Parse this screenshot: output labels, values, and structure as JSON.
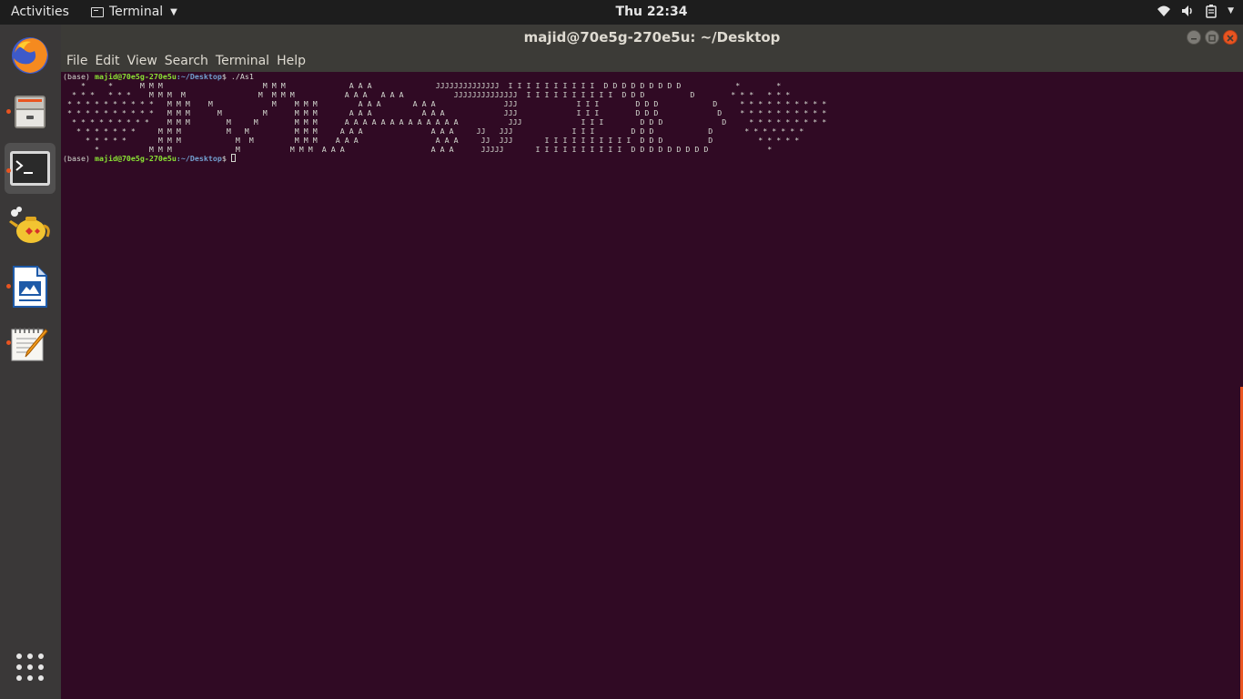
{
  "topbar": {
    "activities": "Activities",
    "app_name": "Terminal",
    "clock": "Thu 22:34"
  },
  "window": {
    "title": "majid@70e5g-270e5u: ~/Desktop",
    "menu": [
      "File",
      "Edit",
      "View",
      "Search",
      "Terminal",
      "Help"
    ]
  },
  "terminal": {
    "prompt_prefix": "(base) ",
    "prompt_user": "majid@70e5g-270e5u",
    "prompt_path": ":~/Desktop",
    "prompt_suffix": "$ ",
    "command": "./As1",
    "output_lines": [
      "    *     *      M M M                      M M M              A A A              JJJJJJJJJJJJJJ  I I I I I I I I I I  D D D D D D D D D            *        *",
      "  * * *   * * *    M M M  M                M  M M M           A A A   A A A           JJJJJJJJJJJJJJ  I I I I I I I I I I  D D D          D        * * *   * * *",
      " * * * * * * * * * *   M M M    M             M    M M M         A A A       A A A               JJJ             I I I        D D D            D     * * * * * * * * * *",
      " * * * * * * * * * *   M M M      M         M      M M M       A A A           A A A             JJJ             I I I        D D D             D    * * * * * * * * * *",
      "  * * * * * * * * *    M M M        M     M        M M M      A A A A A A A A A A A A A           JJJ             I I I        D D D             D     * * * * * * * * *",
      "   * * * * * * *     M M M          M   M          M M M     A A A               A A A     JJ   JJJ             I I I        D D D            D       * * * * * * *",
      "     * * * * *       M M M            M  M         M M M    A A A                 A A A     JJ  JJJ       I I I I I I I I I I  D D D          D          * * * * *",
      "       *           M M M              M           M M M  A A A                   A A A      JJJJJ       I I I I I I I I I I  D D D D D D D D D             *"
    ]
  }
}
